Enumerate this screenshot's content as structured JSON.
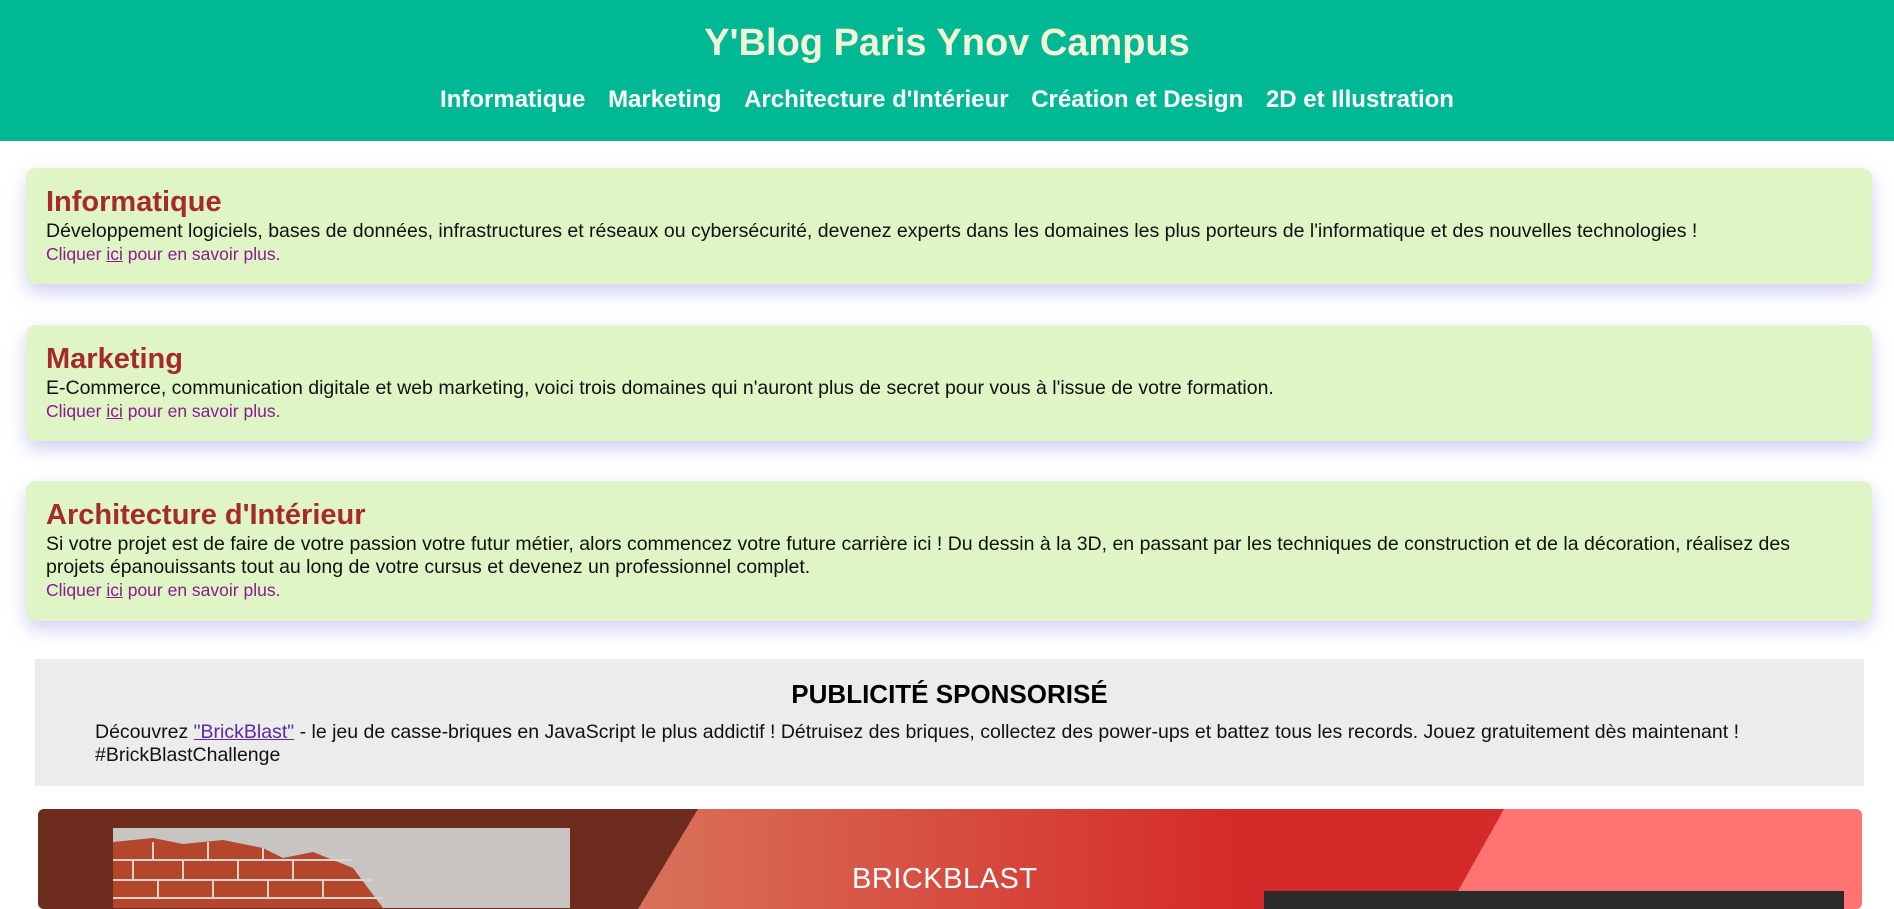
{
  "header": {
    "title": "Y'Blog Paris Ynov Campus",
    "nav": [
      "Informatique",
      "Marketing",
      "Architecture d'Intérieur",
      "Création et Design",
      "2D et Illustration"
    ]
  },
  "cards": [
    {
      "title": "Informatique",
      "description": "Développement logiciels, bases de données, infrastructures et réseaux ou cybersécurité, devenez experts dans les domaines les plus porteurs de l'informatique et des nouvelles technologies !",
      "more_prefix": "Cliquer ",
      "more_link": "ici",
      "more_suffix": " pour en savoir plus."
    },
    {
      "title": "Marketing",
      "description": "E-Commerce, communication digitale et web marketing, voici trois domaines qui n'auront plus de secret pour vous à l'issue de votre formation.",
      "more_prefix": "Cliquer ",
      "more_link": "ici",
      "more_suffix": " pour en savoir plus."
    },
    {
      "title": "Architecture d'Intérieur",
      "description": "Si votre projet est de faire de votre passion votre futur métier, alors commencez votre future carrière ici ! Du dessin à la 3D, en passant par les techniques de construction et de la décoration, réalisez des projets épanouissants tout au long de votre cursus et devenez un professionnel complet.",
      "more_prefix": "Cliquer ",
      "more_link": "ici",
      "more_suffix": " pour en savoir plus."
    }
  ],
  "ad": {
    "heading": "PUBLICITÉ SPONSORISÉ",
    "prefix": "Découvrez ",
    "link": "\"BrickBlast\"",
    "body": " - le jeu de casse-briques en JavaScript le plus addictif ! Détruisez des briques, collectez des power-ups et battez tous les records. Jouez gratuitement dès maintenant ! #BrickBlastChallenge"
  },
  "banner": {
    "title": "BRICKBLAST"
  },
  "colors": {
    "header_bg": "#00b894",
    "card_bg": "#dff5c6",
    "card_title": "#a52a2a",
    "link": "#8b1a8f"
  }
}
